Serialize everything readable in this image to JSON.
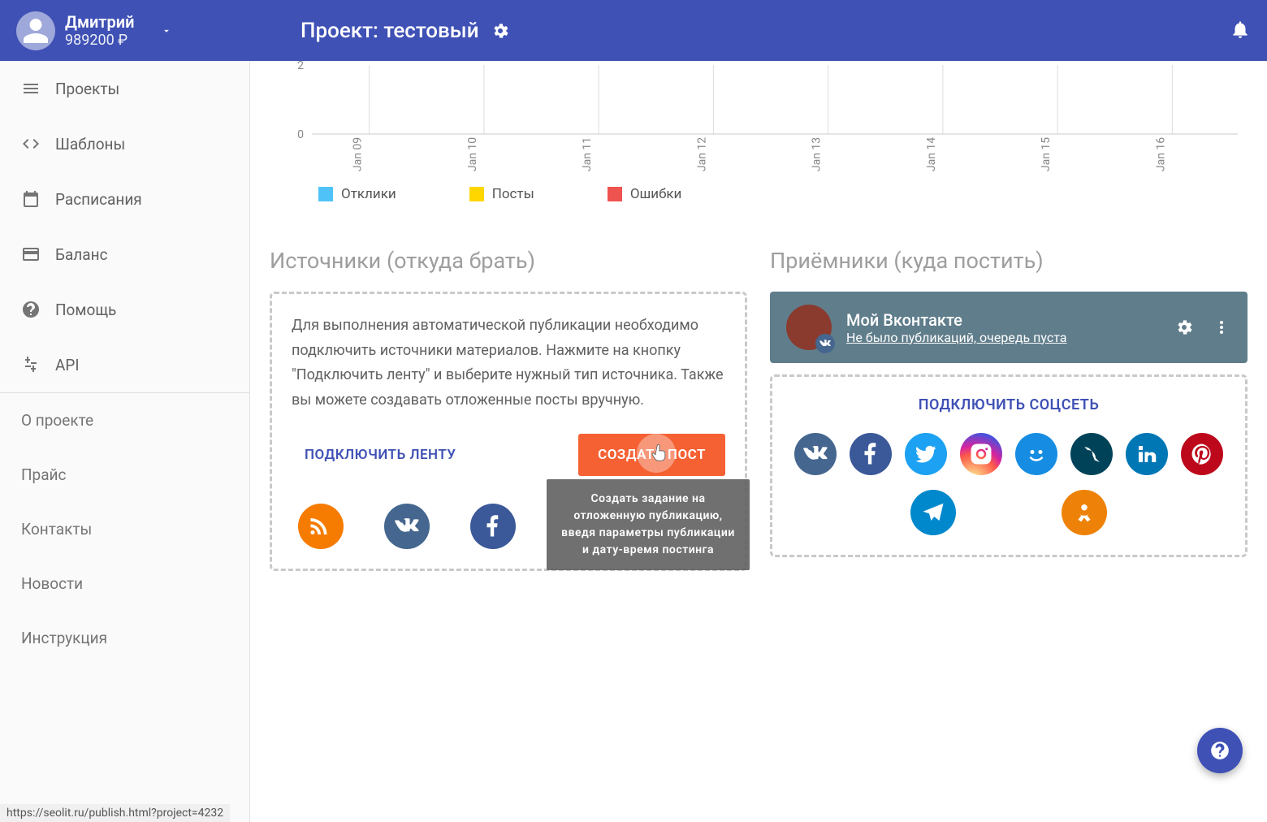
{
  "header": {
    "user_name": "Дмитрий",
    "balance": "989200 ₽",
    "project_label": "Проект: тестовый"
  },
  "sidebar": {
    "items": [
      {
        "label": "Проекты",
        "icon": "menu"
      },
      {
        "label": "Шаблоны",
        "icon": "code"
      },
      {
        "label": "Расписания",
        "icon": "calendar"
      },
      {
        "label": "Баланс",
        "icon": "card"
      },
      {
        "label": "Помощь",
        "icon": "help"
      },
      {
        "label": "API",
        "icon": "api"
      }
    ],
    "simple": [
      "О проекте",
      "Прайс",
      "Контакты",
      "Новости",
      "Инструкция"
    ]
  },
  "chart_data": {
    "type": "bar",
    "categories": [
      "Jan 09",
      "Jan 10",
      "Jan 11",
      "Jan 12",
      "Jan 13",
      "Jan 14",
      "Jan 15",
      "Jan 16"
    ],
    "series": [
      {
        "name": "Отклики",
        "color": "#4fc3f7",
        "values": [
          0,
          0,
          0,
          0,
          0,
          0,
          0,
          0
        ]
      },
      {
        "name": "Посты",
        "color": "#ffd600",
        "values": [
          0,
          0,
          0,
          0,
          0,
          0,
          0,
          0
        ]
      },
      {
        "name": "Ошибки",
        "color": "#ef5350",
        "values": [
          0,
          0,
          0,
          0,
          0,
          0,
          0,
          0
        ]
      }
    ],
    "y_ticks": [
      0,
      2
    ],
    "ylim": [
      0,
      2
    ]
  },
  "sources": {
    "title": "Источники (откуда брать)",
    "description": "Для выполнения автоматической публикации необходимо подключить источники материалов. Нажмите на кнопку \"Подключить ленту\" и выберите нужный тип источника. Также вы можете создавать отложенные посты вручную.",
    "connect_btn": "ПОДКЛЮЧИТЬ ЛЕНТУ",
    "create_btn": "СОЗДАТЬ ПОСТ",
    "tooltip": "Создать задание на отложенную публикацию, введя параметры публикации и дату-время постинга"
  },
  "receivers": {
    "title": "Приёмники (куда постить)",
    "card": {
      "name": "Мой Вконтакте",
      "status": "Не было публикаций, очередь пуста"
    },
    "connect_title": "ПОДКЛЮЧИТЬ СОЦСЕТЬ"
  },
  "status_url": "https://seolit.ru/publish.html?project=4232"
}
